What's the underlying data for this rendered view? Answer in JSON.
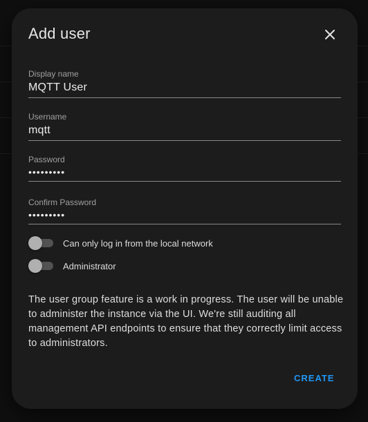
{
  "dialog": {
    "title": "Add user",
    "close_icon": "close-icon"
  },
  "fields": {
    "display_name": {
      "label": "Display name",
      "value": "MQTT User"
    },
    "username": {
      "label": "Username",
      "value": "mqtt"
    },
    "password": {
      "label": "Password",
      "value": "•••••••••"
    },
    "confirm_password": {
      "label": "Confirm Password",
      "value": "•••••••••"
    }
  },
  "toggles": {
    "local_only": {
      "label": "Can only log in from the local network",
      "on": false
    },
    "administrator": {
      "label": "Administrator",
      "on": false
    }
  },
  "note": "The user group feature is a work in progress. The user will be unable to administer the instance via the UI. We're still auditing all management API endpoints to ensure that they correctly limit access to administrators.",
  "actions": {
    "create_label": "CREATE"
  },
  "colors": {
    "accent": "#2196f3",
    "dialog_bg": "#1c1c1c",
    "page_bg": "#0f0f0f"
  }
}
